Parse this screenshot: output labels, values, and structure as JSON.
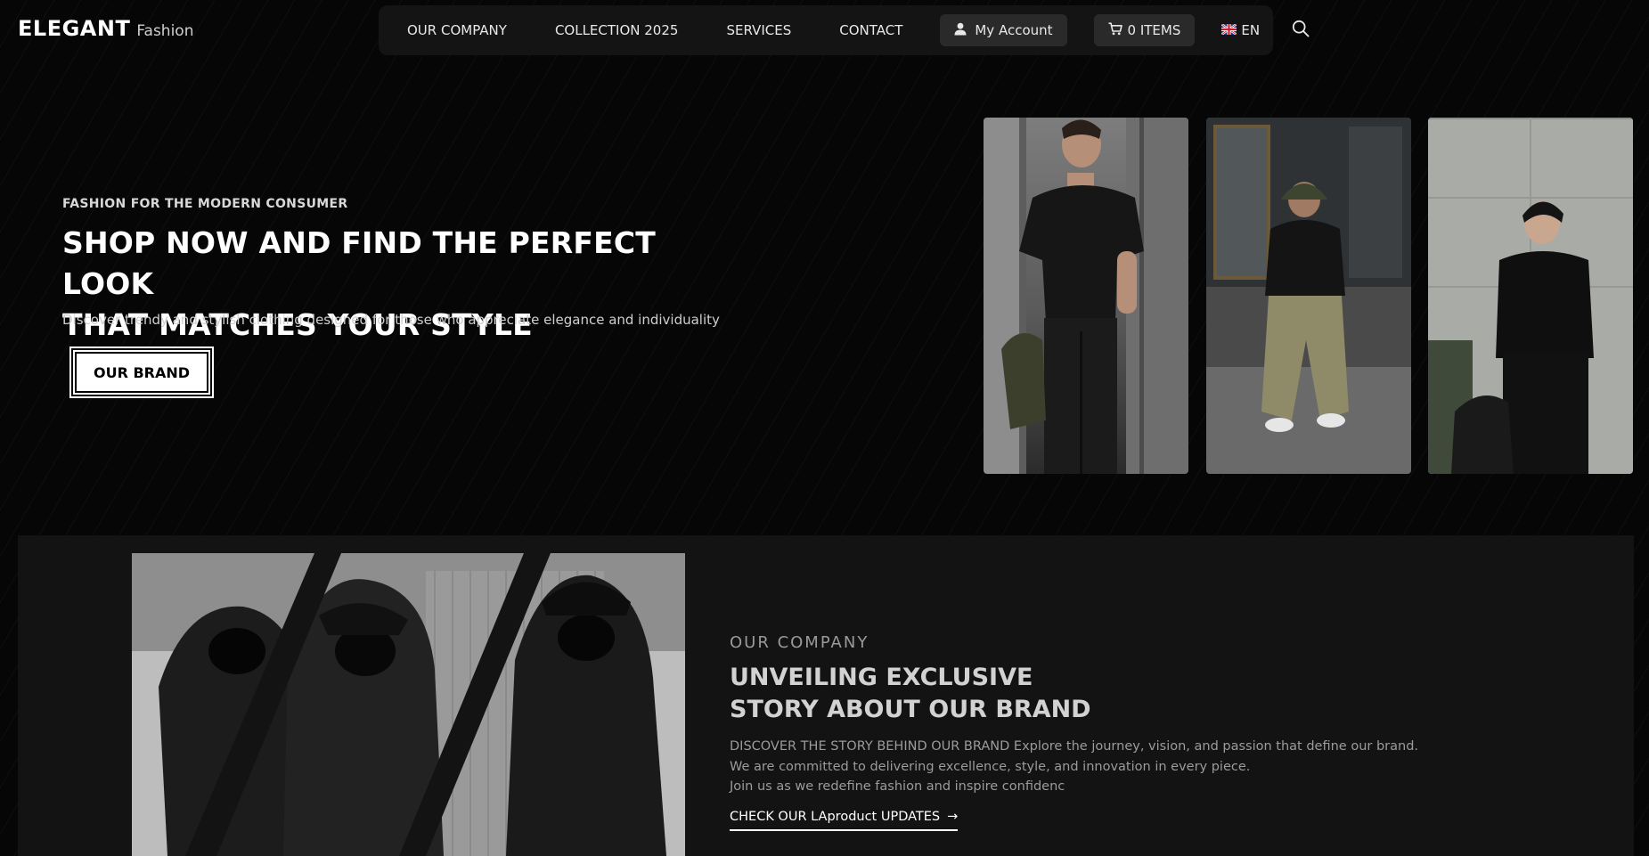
{
  "header": {
    "logo_main": "ELEGANT",
    "logo_sub": "Fashion"
  },
  "nav": {
    "items": [
      {
        "label": "OUR COMPANY"
      },
      {
        "label": "COLLECTION 2025"
      },
      {
        "label": "SERVICES"
      },
      {
        "label": "CONTACT"
      }
    ],
    "account_label": "My Account",
    "account_icon": "user-icon",
    "cart_label": "0 ITEMS",
    "cart_icon": "cart-icon",
    "language_label": "EN",
    "language_icon": "uk-flag-icon",
    "search_icon": "search-icon"
  },
  "hero": {
    "eyebrow": "FASHION FOR THE MODERN CONSUMER",
    "title_line1": "SHOP NOW AND FIND THE PERFECT LOOK",
    "title_line2": "THAT MATCHES YOUR STYLE",
    "description": "Discover trendy and stylish clothing designed for those who appreciate elegance and individuality",
    "button_label": "OUR BRAND"
  },
  "company": {
    "eyebrow": "OUR COMPANY",
    "title_line1": "UNVEILING EXCLUSIVE",
    "title_line2": "STORY ABOUT OUR BRAND",
    "desc_line1": "DISCOVER THE STORY BEHIND OUR BRAND Explore the journey, vision, and passion that define our brand.",
    "desc_line2": "We are committed to delivering excellence, style, and innovation in every piece.",
    "desc_line3": "Join us as we redefine fashion and inspire confidenc",
    "link_label": "CHECK OUR LAproduct UPDATES",
    "link_arrow": "→"
  },
  "colors": {
    "background": "#060606",
    "navbar": "#141414",
    "pill": "#2a2a2a",
    "section": "#131313",
    "text_primary": "#ffffff",
    "text_muted": "#9b9b9b"
  }
}
